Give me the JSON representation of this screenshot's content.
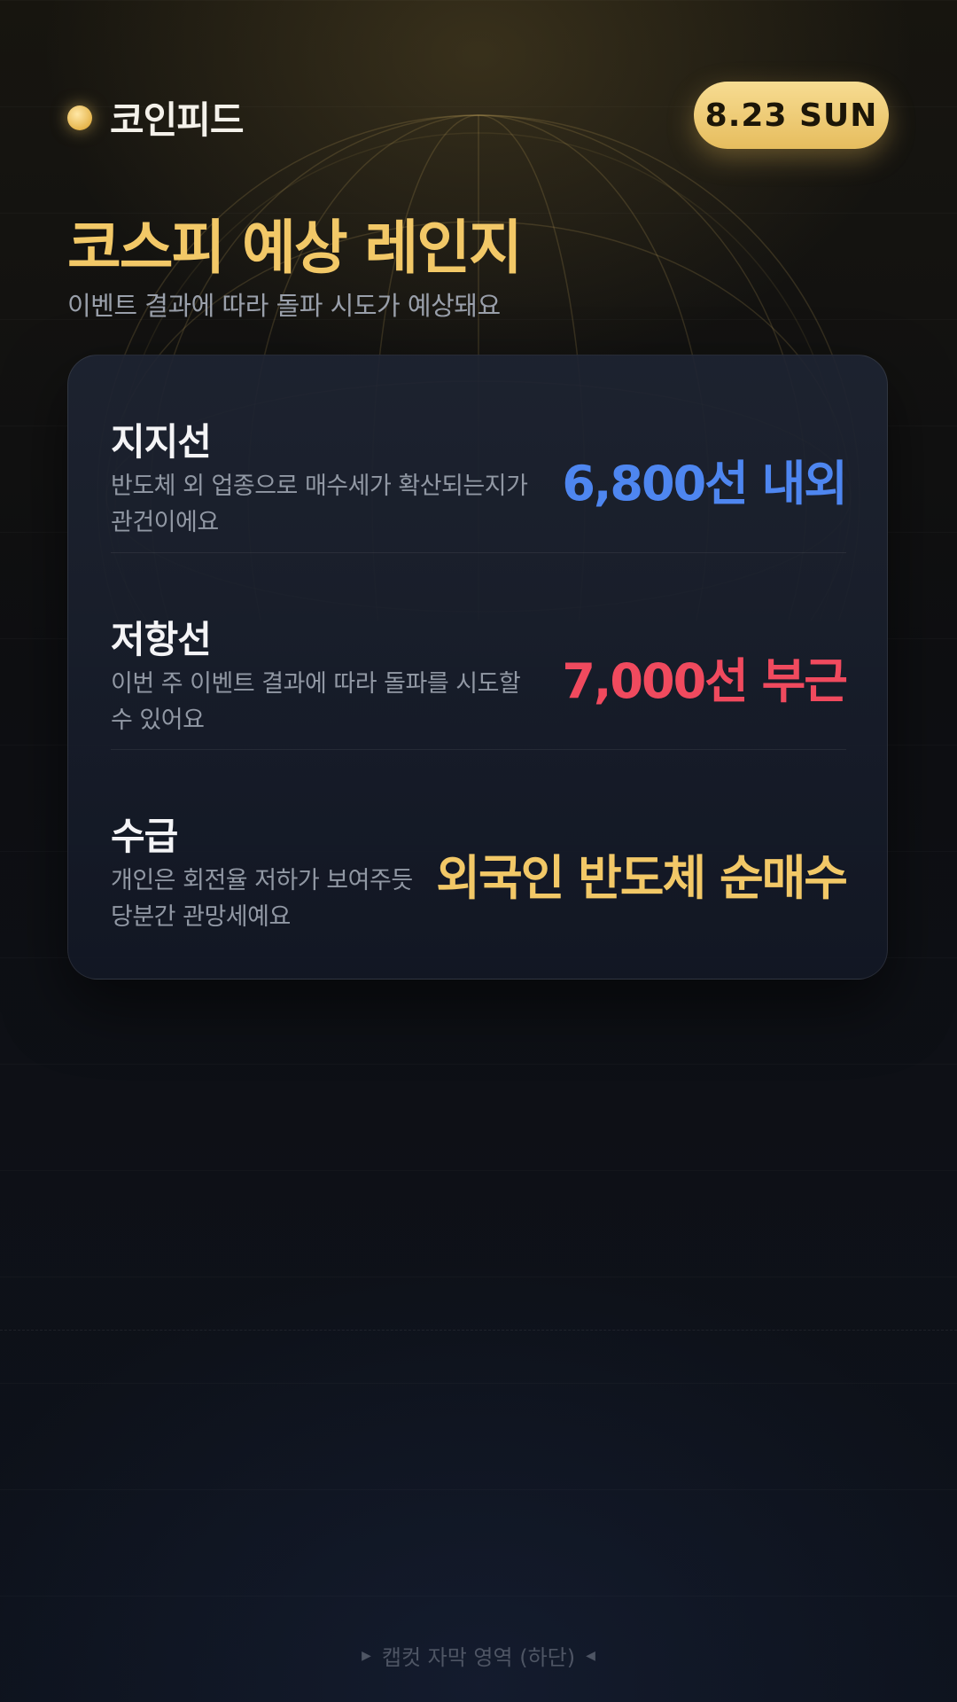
{
  "brand": {
    "name": "코인피드",
    "dot_icon": "gold-dot-icon"
  },
  "date_badge": "8.23 SUN",
  "title": "코스피 예상 레인지",
  "subtitle": "이벤트 결과에 따라 돌파 시도가 예상돼요",
  "rows": [
    {
      "label": "지지선",
      "desc_line1": "반도체 외 업종으로 매수세가 확산되는지가",
      "desc_line2": "관건이에요",
      "value": "6,800선 내외",
      "color": "#4e86f0"
    },
    {
      "label": "저항선",
      "desc_line1": "이번 주 이벤트 결과에 따라 돌파를 시도할",
      "desc_line2": "수 있어요",
      "value": "7,000선 부근",
      "color": "#f04a5e"
    },
    {
      "label": "수급",
      "desc_line1": "개인은 회전율 저하가 보여주듯",
      "desc_line2": "당분간 관망세예요",
      "value": "외국인 반도체 순매수",
      "color": "#f2c867"
    }
  ],
  "caption": {
    "text": "캡컷 자막 영역 (하단)",
    "left_icon": "triangle-right-icon",
    "right_icon": "triangle-left-icon"
  },
  "colors": {
    "accent_gold": "#f2c867",
    "background": "#0c1018",
    "card": "#1a2030"
  }
}
